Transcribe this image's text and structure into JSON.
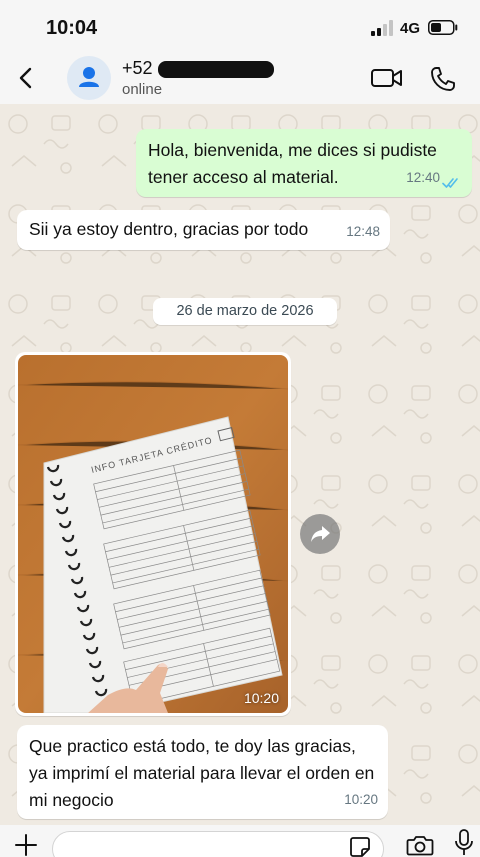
{
  "status_bar": {
    "time": "10:04",
    "network": "4G"
  },
  "header": {
    "contact_name": "+52",
    "contact_status": "online",
    "icons": [
      "back-arrow-icon",
      "avatar-person-icon",
      "video-camera-icon",
      "phone-icon"
    ]
  },
  "messages": [
    {
      "direction": "out",
      "text": "Hola, bienvenida, me dices si pudiste tener acceso al material.",
      "time": "12:40",
      "status": "read"
    },
    {
      "direction": "in",
      "text": "Sii ya estoy dentro, gracias por todo",
      "time": "12:48"
    }
  ],
  "date_separator": "26 de marzo de 2026",
  "image_message": {
    "time": "10:20",
    "sheet_title": "INFO TARJETA CRÉDITO"
  },
  "last_message": {
    "direction": "in",
    "text": "Que practico está todo, te doy las gracias, ya imprimí el material para llevar el orden en mi negocio",
    "time": "10:20"
  },
  "composer": {
    "icons": [
      "plus-icon",
      "sticker-icon",
      "camera-icon",
      "microphone-icon"
    ]
  },
  "colors": {
    "outgoing_bubble": "#d9fdd3",
    "incoming_bubble": "#ffffff",
    "chat_background": "#efeae2",
    "read_ticks": "#53bdeb",
    "accent": "#1a73e8"
  }
}
